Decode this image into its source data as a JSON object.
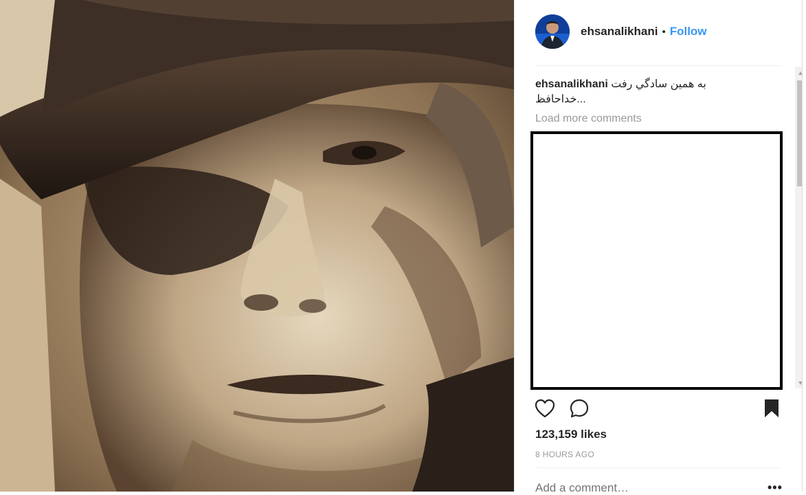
{
  "post": {
    "username": "ehsanalikhani",
    "separator": "•",
    "follow_label": "Follow",
    "caption_user": "ehsanalikhani",
    "caption_text": "به همین سادگي رفت",
    "caption_text_2": "خداحافظ...",
    "load_more_label": "Load more comments",
    "likes": "123,159 likes",
    "time_ago": "8 HOURS AGO",
    "add_comment_placeholder": "Add a comment…",
    "more_options": "•••"
  },
  "icons": {
    "avatar": "profile-photo",
    "like": "heart-outline-icon",
    "comment": "speech-bubble-icon",
    "save": "bookmark-filled-icon",
    "options": "ellipsis-icon"
  },
  "colors": {
    "follow_blue": "#3897f0",
    "text": "#262626",
    "muted": "#999999",
    "sepia_light": "#d9c9aa",
    "sepia_dark": "#2e2118"
  }
}
